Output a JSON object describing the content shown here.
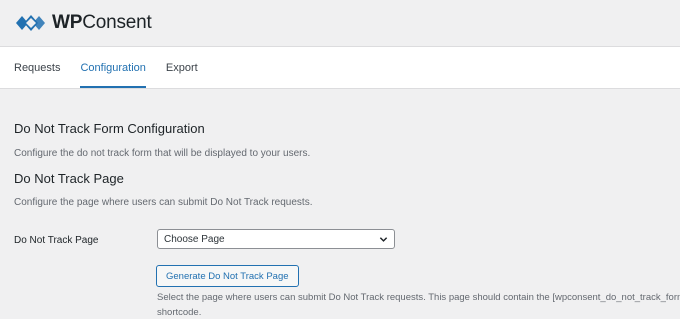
{
  "brand": {
    "name_bold": "WP",
    "name_rest": "Consent",
    "color": "#2271b1"
  },
  "tabs": [
    {
      "label": "Requests",
      "active": false
    },
    {
      "label": "Configuration",
      "active": true
    },
    {
      "label": "Export",
      "active": false
    }
  ],
  "form_config": {
    "title": "Do Not Track Form Configuration",
    "description": "Configure the do not track form that will be displayed to your users."
  },
  "page_section": {
    "title": "Do Not Track Page",
    "description": "Configure the page where users can submit Do Not Track requests.",
    "field_label": "Do Not Track Page",
    "select_value": "Choose Page",
    "button_label": "Generate Do Not Track Page",
    "help_line1": "Select the page where users can submit Do Not Track requests. This page should contain the [wpconsent_do_not_track_form]",
    "help_line2": "shortcode."
  }
}
